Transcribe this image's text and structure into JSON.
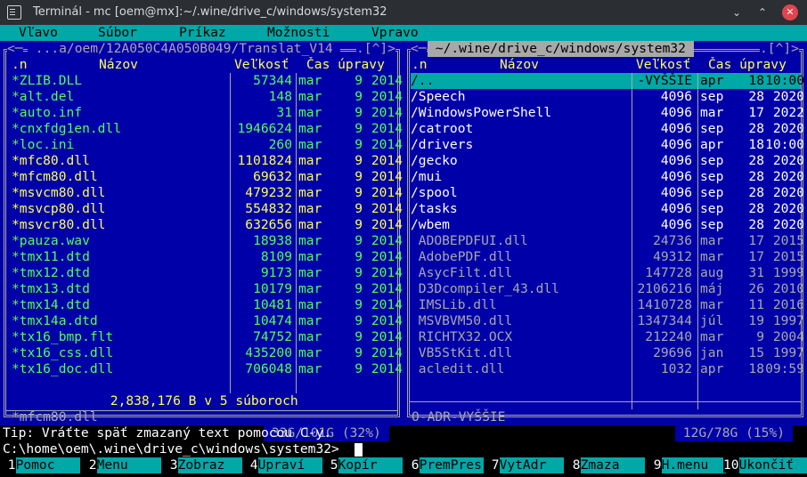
{
  "window": {
    "title": "Terminál - mc [oem@mx]:~/.wine/drive_c/windows/system32",
    "buttons": {
      "minimize": "⌄",
      "maximize": "⌃",
      "close": "✕"
    }
  },
  "menu": [
    "Vľavo",
    "Súbor",
    "Príkaz",
    "Možnosti",
    "Vpravo"
  ],
  "left_panel": {
    "title": " ...a/oem/12A050C4A050B049/Translat_V14 ",
    "corner": ".[^]>",
    "headers": {
      "sort": ".n",
      "name": "Názov",
      "size": "Veľkosť",
      "time": "Čas úpravy"
    },
    "files": [
      {
        "name": "*ZLIB.DLL",
        "size": "57344",
        "mon": "mar",
        "day": "9",
        "year": "2014",
        "kind": "exe"
      },
      {
        "name": "*alt.del",
        "size": "148",
        "mon": "mar",
        "day": "9",
        "year": "2014",
        "kind": "exe"
      },
      {
        "name": "*auto.inf",
        "size": "31",
        "mon": "mar",
        "day": "9",
        "year": "2014",
        "kind": "exe"
      },
      {
        "name": "*cnxfdg1en.dll",
        "size": "1946624",
        "mon": "mar",
        "day": "9",
        "year": "2014",
        "kind": "exe"
      },
      {
        "name": "*loc.ini",
        "size": "260",
        "mon": "mar",
        "day": "9",
        "year": "2014",
        "kind": "exe"
      },
      {
        "name": "*mfc80.dll",
        "size": "1101824",
        "mon": "mar",
        "day": "9",
        "year": "2014",
        "kind": "gold"
      },
      {
        "name": "*mfcm80.dll",
        "size": "69632",
        "mon": "mar",
        "day": "9",
        "year": "2014",
        "kind": "gold"
      },
      {
        "name": "*msvcm80.dll",
        "size": "479232",
        "mon": "mar",
        "day": "9",
        "year": "2014",
        "kind": "gold"
      },
      {
        "name": "*msvcp80.dll",
        "size": "554832",
        "mon": "mar",
        "day": "9",
        "year": "2014",
        "kind": "gold"
      },
      {
        "name": "*msvcr80.dll",
        "size": "632656",
        "mon": "mar",
        "day": "9",
        "year": "2014",
        "kind": "gold"
      },
      {
        "name": "*pauza.wav",
        "size": "18938",
        "mon": "mar",
        "day": "9",
        "year": "2014",
        "kind": "exe"
      },
      {
        "name": "*tmx11.dtd",
        "size": "8109",
        "mon": "mar",
        "day": "9",
        "year": "2014",
        "kind": "exe"
      },
      {
        "name": "*tmx12.dtd",
        "size": "9173",
        "mon": "mar",
        "day": "9",
        "year": "2014",
        "kind": "exe"
      },
      {
        "name": "*tmx13.dtd",
        "size": "10179",
        "mon": "mar",
        "day": "9",
        "year": "2014",
        "kind": "exe"
      },
      {
        "name": "*tmx14.dtd",
        "size": "10481",
        "mon": "mar",
        "day": "9",
        "year": "2014",
        "kind": "exe"
      },
      {
        "name": "*tmx14a.dtd",
        "size": "10474",
        "mon": "mar",
        "day": "9",
        "year": "2014",
        "kind": "exe"
      },
      {
        "name": "*tx16_bmp.flt",
        "size": "74752",
        "mon": "mar",
        "day": "9",
        "year": "2014",
        "kind": "exe"
      },
      {
        "name": "*tx16_css.dll",
        "size": "435200",
        "mon": "mar",
        "day": "9",
        "year": "2014",
        "kind": "exe"
      },
      {
        "name": "*tx16_doc.dll",
        "size": "706048",
        "mon": "mar",
        "day": "9",
        "year": "2014",
        "kind": "exe"
      }
    ],
    "summary": " 2,838,176 B v 5 súboroch ",
    "status": "*mfcm80.dll",
    "disk": " 33G/101G (32%) "
  },
  "right_panel": {
    "title": " ~/.wine/drive_c/windows/system32 ",
    "corner": ".[^]>",
    "headers": {
      "sort": ".n",
      "name": "Názov",
      "size": "Veľkosť",
      "time": "Čas úpravy"
    },
    "files": [
      {
        "name": "/..",
        "size": "-VYŠŠIE",
        "mon": "apr",
        "day": "18",
        "year": "10:00",
        "kind": "cursor"
      },
      {
        "name": "/Speech",
        "size": "4096",
        "mon": "sep",
        "day": "28",
        "year": "2020",
        "kind": "dir"
      },
      {
        "name": "/WindowsPowerShell",
        "size": "4096",
        "mon": "mar",
        "day": "17",
        "year": "2022",
        "kind": "dir"
      },
      {
        "name": "/catroot",
        "size": "4096",
        "mon": "sep",
        "day": "28",
        "year": "2020",
        "kind": "dir"
      },
      {
        "name": "/drivers",
        "size": "4096",
        "mon": "apr",
        "day": "18",
        "year": "10:00",
        "kind": "dir"
      },
      {
        "name": "/gecko",
        "size": "4096",
        "mon": "sep",
        "day": "28",
        "year": "2020",
        "kind": "dir"
      },
      {
        "name": "/mui",
        "size": "4096",
        "mon": "sep",
        "day": "28",
        "year": "2020",
        "kind": "dir"
      },
      {
        "name": "/spool",
        "size": "4096",
        "mon": "sep",
        "day": "28",
        "year": "2020",
        "kind": "dir"
      },
      {
        "name": "/tasks",
        "size": "4096",
        "mon": "sep",
        "day": "28",
        "year": "2020",
        "kind": "dir"
      },
      {
        "name": "/wbem",
        "size": "4096",
        "mon": "sep",
        "day": "28",
        "year": "2020",
        "kind": "dir"
      },
      {
        "name": " ADOBEPDFUI.dll",
        "size": "24736",
        "mon": "mar",
        "day": "17",
        "year": "2015",
        "kind": "dim"
      },
      {
        "name": " AdobePDF.dll",
        "size": "49312",
        "mon": "mar",
        "day": "17",
        "year": "2015",
        "kind": "dim"
      },
      {
        "name": " AsycFilt.dll",
        "size": "147728",
        "mon": "aug",
        "day": "31",
        "year": "1999",
        "kind": "dim"
      },
      {
        "name": " D3Dcompiler_43.dll",
        "size": "2106216",
        "mon": "máj",
        "day": "26",
        "year": "2010",
        "kind": "dim"
      },
      {
        "name": " IMSLib.dll",
        "size": "1410728",
        "mon": "mar",
        "day": "11",
        "year": "2016",
        "kind": "dim"
      },
      {
        "name": " MSVBVM50.dll",
        "size": "1347344",
        "mon": "júl",
        "day": "19",
        "year": "1997",
        "kind": "dim"
      },
      {
        "name": " RICHTX32.OCX",
        "size": "212240",
        "mon": "mar",
        "day": "9",
        "year": "2004",
        "kind": "dim"
      },
      {
        "name": " VB5StKit.dll",
        "size": "29696",
        "mon": "jan",
        "day": "15",
        "year": "1997",
        "kind": "dim"
      },
      {
        "name": " acledit.dll",
        "size": "1032",
        "mon": "apr",
        "day": "18",
        "year": "09:59",
        "kind": "dim"
      }
    ],
    "status": "O-ADR-VYŠŠIE",
    "disk": " 12G/78G (15%) "
  },
  "tip": "Tip: Vráťte späť zmazaný text pomocou C-y.",
  "prompt": "C:\\home\\oem\\.wine\\drive_c\\windows\\system32>",
  "fkeys": [
    {
      "n": " 1",
      "l": "Pomoc"
    },
    {
      "n": " 2",
      "l": "Menu"
    },
    {
      "n": " 3",
      "l": "Zobraz"
    },
    {
      "n": " 4",
      "l": "Upraví"
    },
    {
      "n": " 5",
      "l": "Kopír"
    },
    {
      "n": " 6",
      "l": "PremPres"
    },
    {
      "n": " 7",
      "l": "VytAdr"
    },
    {
      "n": " 8",
      "l": "Zmaza"
    },
    {
      "n": " 9",
      "l": "H.menu"
    },
    {
      "n": "10",
      "l": "Ukončiť"
    }
  ]
}
